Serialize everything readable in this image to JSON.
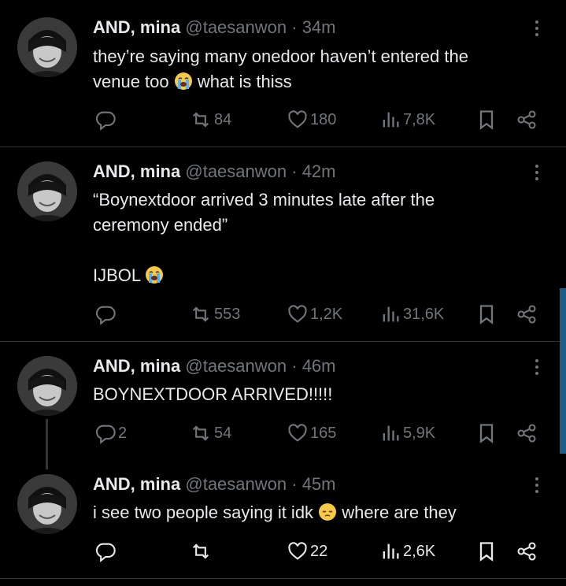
{
  "tweets": [
    {
      "name": "AND, mina",
      "handle": "@taesanwon",
      "time": "· 34m",
      "lines": [
        "they’re saying many onedoor haven’t entered the",
        "venue too ",
        " what is thiss"
      ],
      "emoji": "loudly-crying-face",
      "reply_count": "",
      "retweets": "84",
      "likes": "180",
      "views": "7,8K"
    },
    {
      "name": "AND, mina",
      "handle": "@taesanwon",
      "time": "· 42m",
      "lines": [
        "“Boynextdoor arrived 3 minutes late after the",
        "ceremony ended”",
        "IJBOL "
      ],
      "emoji": "loudly-crying-face",
      "reply_count": "",
      "retweets": "553",
      "likes": "1,2K",
      "views": "31,6K"
    },
    {
      "name": "AND, mina",
      "handle": "@taesanwon",
      "time": "· 46m",
      "lines": [
        "BOYNEXTDOOR ARRIVED!!!!!"
      ],
      "reply_count": "2",
      "retweets": "54",
      "likes": "165",
      "views": "5,9K"
    },
    {
      "name": "AND, mina",
      "handle": "@taesanwon",
      "time": "· 45m",
      "lines": [
        "i see two people saying it idk ",
        " where are they"
      ],
      "emoji": "pensive-face",
      "reply_count": "",
      "retweets": "",
      "likes": "22",
      "views": "2,6K"
    }
  ],
  "colors": {
    "background": "#000000",
    "text": "#e7e9ea",
    "secondary": "#71767b",
    "separator": "#2f3336",
    "scrollbar": "#1d5d8a"
  },
  "icons": [
    "reply-icon",
    "retweet-icon",
    "like-icon",
    "views-icon",
    "bookmark-icon",
    "share-icon",
    "more-icon"
  ]
}
